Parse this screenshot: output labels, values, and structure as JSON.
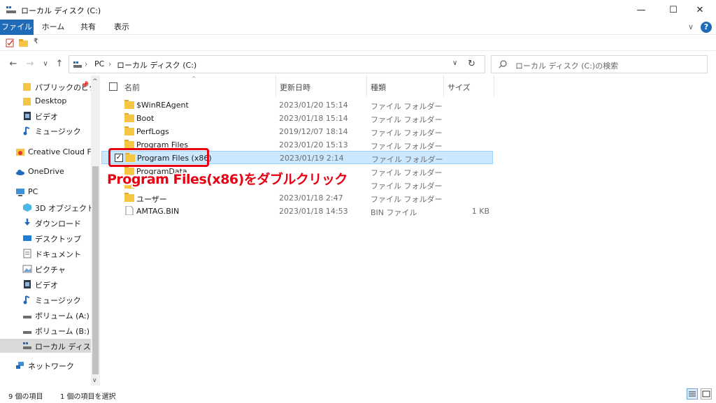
{
  "window": {
    "title": "ローカル ディスク (C:)",
    "minimize_glyph": "—",
    "maximize_glyph": "☐",
    "close_glyph": "✕"
  },
  "ribbon": {
    "tabs": [
      "ファイル",
      "ホーム",
      "共有",
      "表示"
    ],
    "help_glyph": "?",
    "collapse_glyph": "∨"
  },
  "quick_access": {
    "icons": [
      "properties-icon",
      "new-folder-icon",
      "customize-dropdown-icon"
    ],
    "dropdown_glyph": "₹"
  },
  "navigation": {
    "back_glyph": "←",
    "forward_glyph": "→",
    "recent_glyph": "∨",
    "up_glyph": "↑",
    "breadcrumb": [
      "PC",
      "ローカル ディスク (C:)"
    ],
    "separator": "›",
    "dropdown_glyph": "∨",
    "refresh_glyph": "↻"
  },
  "search": {
    "placeholder": "ローカル ディスク (C:)の検索"
  },
  "sidebar": {
    "items": [
      {
        "label": "パブリックのピクチ",
        "icon": "folder-icon",
        "pinned": "📌"
      },
      {
        "label": "Desktop",
        "icon": "folder-icon"
      },
      {
        "label": "ビデオ",
        "icon": "video-icon"
      },
      {
        "label": "ミュージック",
        "icon": "music-icon"
      },
      {
        "label": "Creative Cloud File",
        "icon": "creative-cloud-icon"
      },
      {
        "label": "OneDrive",
        "icon": "cloud-icon"
      },
      {
        "label": "PC",
        "icon": "pc-icon"
      },
      {
        "label": "3D オブジェクト",
        "icon": "3d-objects-icon"
      },
      {
        "label": "ダウンロード",
        "icon": "download-icon"
      },
      {
        "label": "デスクトップ",
        "icon": "desktop-icon"
      },
      {
        "label": "ドキュメント",
        "icon": "document-icon"
      },
      {
        "label": "ピクチャ",
        "icon": "pictures-icon"
      },
      {
        "label": "ビデオ",
        "icon": "video-icon"
      },
      {
        "label": "ミュージック",
        "icon": "music-icon"
      },
      {
        "label": "ボリューム (A:)",
        "icon": "drive-icon"
      },
      {
        "label": "ボリューム (B:)",
        "icon": "drive-icon"
      },
      {
        "label": "ローカル ディスク (C",
        "icon": "system-drive-icon"
      },
      {
        "label": "ネットワーク",
        "icon": "network-icon"
      }
    ],
    "scroll_up_glyph": "^",
    "scroll_down_glyph": "∨"
  },
  "columns": {
    "name": "名前",
    "date": "更新日時",
    "type": "種類",
    "size": "サイズ",
    "sort_glyph": "^"
  },
  "files": [
    {
      "name": "$WinREAgent",
      "date": "2023/01/20 15:14",
      "type": "ファイル フォルダー",
      "size": "",
      "kind": "folder"
    },
    {
      "name": "Boot",
      "date": "2023/01/18 15:14",
      "type": "ファイル フォルダー",
      "size": "",
      "kind": "folder"
    },
    {
      "name": "PerfLogs",
      "date": "2019/12/07 18:14",
      "type": "ファイル フォルダー",
      "size": "",
      "kind": "folder"
    },
    {
      "name": "Program Files",
      "date": "2023/01/20 15:13",
      "type": "ファイル フォルダー",
      "size": "",
      "kind": "folder"
    },
    {
      "name": "Program Files (x86)",
      "date": "2023/01/19 2:14",
      "type": "ファイル フォルダー",
      "size": "",
      "kind": "folder",
      "selected": true
    },
    {
      "name": "ProgramData",
      "date": "",
      "type": "ファイル フォルダー",
      "size": "",
      "kind": "folder"
    },
    {
      "name": "",
      "date": "",
      "type": "ファイル フォルダー",
      "size": "",
      "kind": "folder"
    },
    {
      "name": "ユーザー",
      "date": "2023/01/18 2:47",
      "type": "ファイル フォルダー",
      "size": "",
      "kind": "folder"
    },
    {
      "name": "AMTAG.BIN",
      "date": "2023/01/18 14:53",
      "type": "BIN ファイル",
      "size": "1 KB",
      "kind": "file"
    }
  ],
  "annotation": {
    "text": "Program Files(x86)をダブルクリック",
    "color": "#e60012"
  },
  "status": {
    "item_count": "9 個の項目",
    "selected_count": "1 個の項目を選択"
  },
  "colors": {
    "accent": "#1f6bb8",
    "selection_bg": "#cce8ff",
    "selection_border": "#99d1ff",
    "folder": "#f5c543"
  }
}
